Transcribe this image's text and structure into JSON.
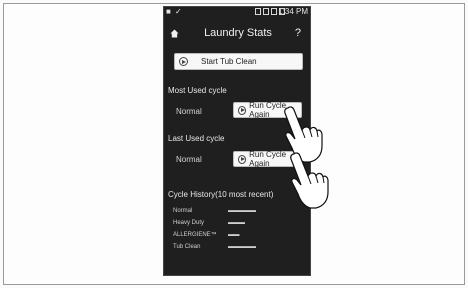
{
  "status_bar": {
    "left": "■ ✓",
    "time": "1:34 PM"
  },
  "header": {
    "title": "Laundry Stats",
    "help": "?",
    "home_icon": "home-icon"
  },
  "start_tub_clean": {
    "label": "Start Tub Clean"
  },
  "most_used": {
    "section_label": "Most Used cycle",
    "cycle": "Normal",
    "button_label": "Run Cycle Again"
  },
  "last_used": {
    "section_label": "Last Used cycle",
    "cycle": "Normal",
    "button_label": "Run Cycle Again"
  },
  "history": {
    "label": "Cycle History(10 most recent)",
    "rows": [
      {
        "name": "Normal",
        "value": "▬▬▬▬▬"
      },
      {
        "name": "Heavy Duty",
        "value": "▬▬▬"
      },
      {
        "name": "ALLERGIENE™",
        "value": "▬▬"
      },
      {
        "name": "Tub Clean",
        "value": "▬▬▬▬▬"
      }
    ]
  },
  "colors": {
    "phone_bg": "#1f1f1f",
    "button_bg": "#f7f7f7",
    "page_bg": "#fbfbfb"
  }
}
